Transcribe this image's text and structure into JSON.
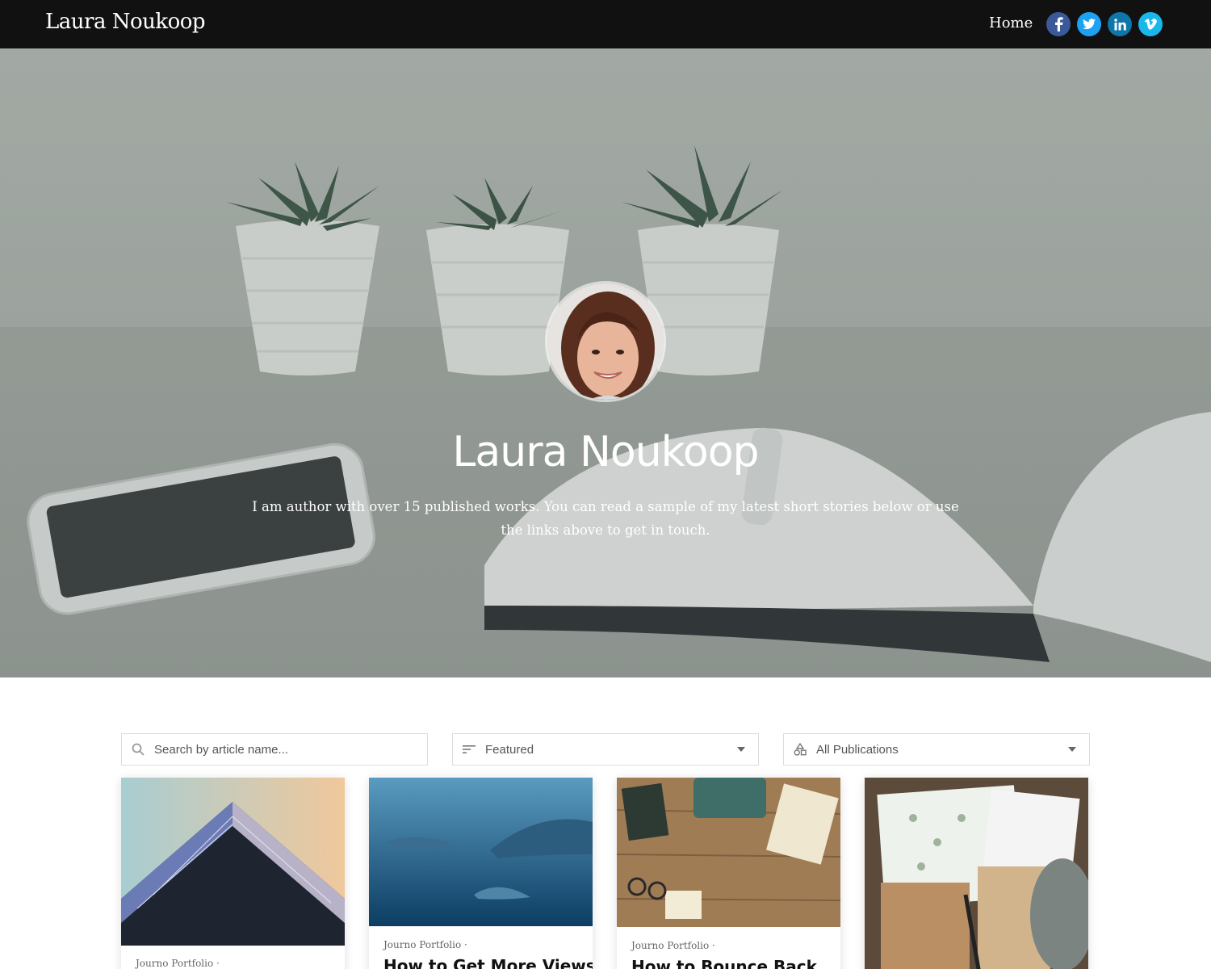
{
  "header": {
    "brand": "Laura Noukoop",
    "nav_home": "Home",
    "social": [
      "facebook-icon",
      "twitter-icon",
      "linkedin-icon",
      "vimeo-icon"
    ]
  },
  "hero": {
    "name": "Laura Noukoop",
    "bio": "I am author with over 15 published works. You can read a sample of my latest short stories below or use the links above to get in touch."
  },
  "filters": {
    "search_placeholder": "Search by article name...",
    "sort_value": "Featured",
    "publication_value": "All Publications"
  },
  "cards": [
    {
      "publication": "Journo Portfolio ·",
      "title": ""
    },
    {
      "publication": "Journo Portfolio ·",
      "title": "How to Get More Views"
    },
    {
      "publication": "Journo Portfolio ·",
      "title": "How to Bounce Back"
    },
    {
      "publication": "",
      "title": ""
    }
  ],
  "colors": {
    "topbar": "#111111",
    "facebook": "#3b5998",
    "twitter": "#1da1f2",
    "linkedin": "#0e76a8",
    "vimeo": "#1ab7ea"
  }
}
